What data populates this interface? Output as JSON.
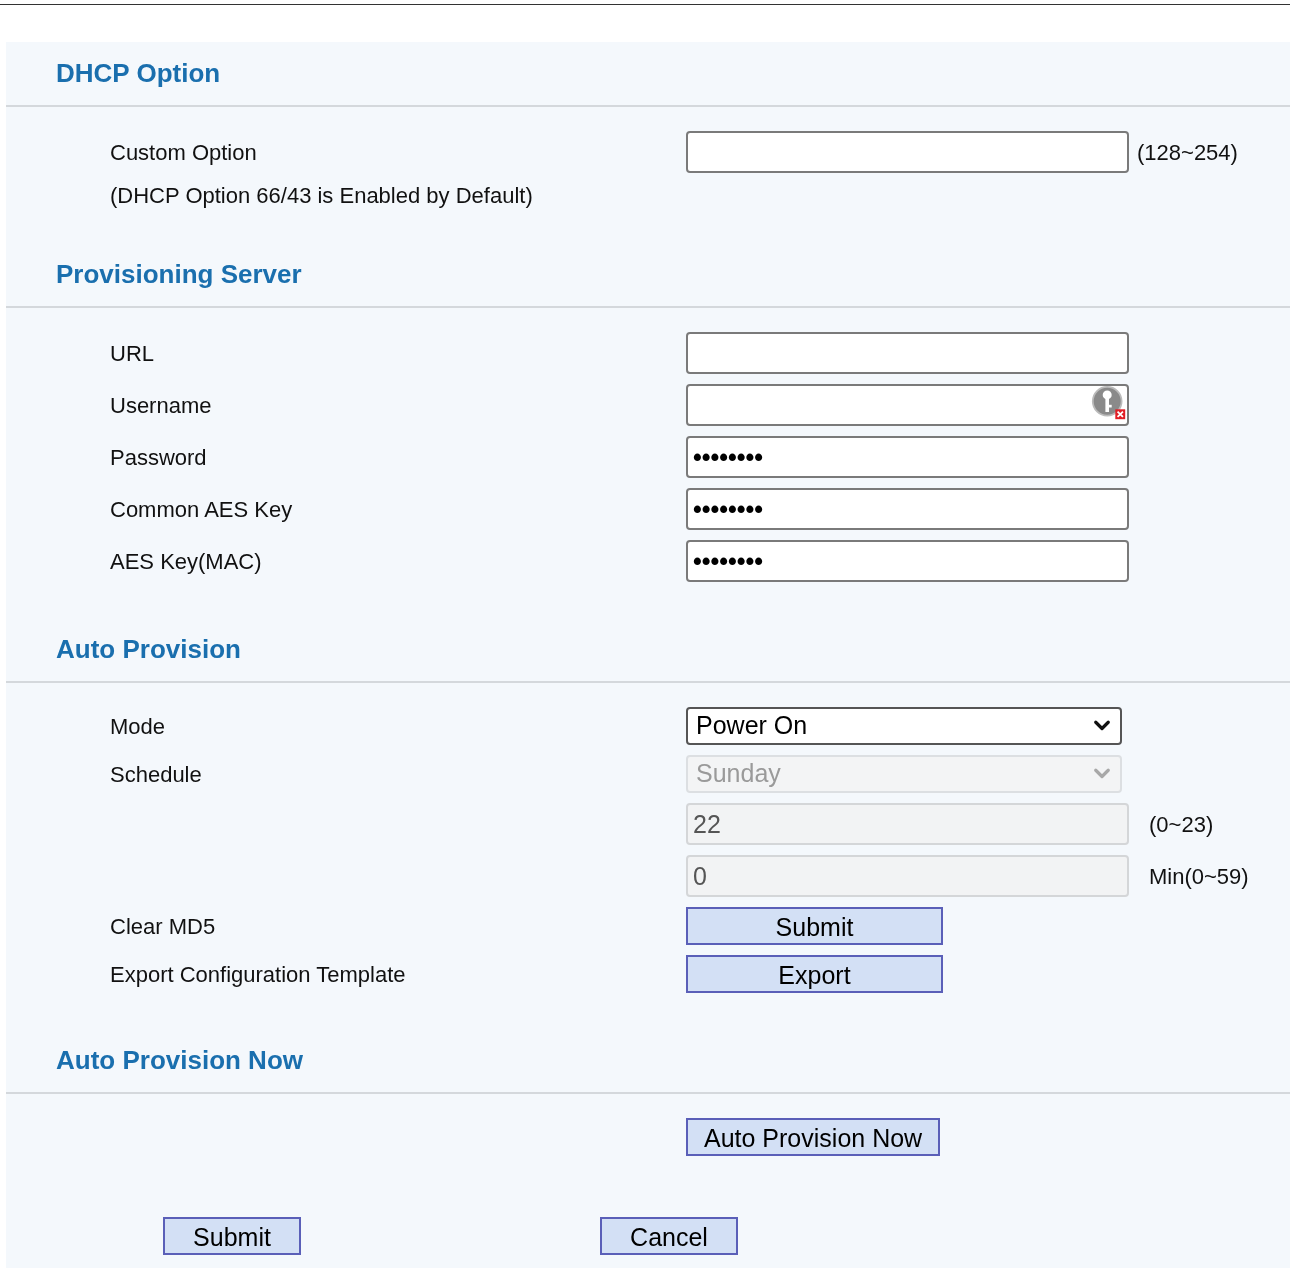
{
  "sections": [
    {
      "title": "DHCP Option",
      "rows": [
        {
          "kind": "input",
          "label": "Custom Option",
          "value": "",
          "hint": "(128~254)",
          "disabled": false
        },
        {
          "kind": "note",
          "label": "(DHCP Option 66/43 is Enabled by Default)"
        }
      ]
    },
    {
      "title": "Provisioning Server",
      "rows": [
        {
          "kind": "input",
          "label": "URL",
          "disabled": false
        },
        {
          "kind": "input",
          "label": "Username",
          "disabled": false,
          "key_icon": true
        },
        {
          "kind": "input",
          "label": "Password",
          "value": "••••••••",
          "disabled": false
        },
        {
          "kind": "input",
          "label": "Common AES Key",
          "value": "••••••••",
          "disabled": false
        },
        {
          "kind": "input",
          "label": "AES Key(MAC)",
          "value": "••••••••",
          "disabled": false
        }
      ]
    },
    {
      "title": "Auto Provision",
      "rows": [
        {
          "kind": "select",
          "label": "Mode",
          "value": "Power On",
          "disabled": false
        },
        {
          "kind": "select",
          "label": "Schedule",
          "value": "Sunday",
          "disabled": true
        },
        {
          "kind": "input",
          "value": "22",
          "hint": "(0~23)",
          "disabled": true
        },
        {
          "kind": "input",
          "value": "0",
          "hint": "Min(0~59)",
          "disabled": true
        },
        {
          "kind": "button",
          "label": "Clear MD5",
          "button": "Submit"
        },
        {
          "kind": "button",
          "label": "Export Configuration Template",
          "button": "Export"
        }
      ]
    },
    {
      "title": "Auto Provision Now",
      "rows": [
        {
          "kind": "button",
          "button": "Auto Provision Now",
          "auto_width": true
        }
      ]
    }
  ],
  "footer_buttons": [
    "Submit",
    "Cancel"
  ]
}
